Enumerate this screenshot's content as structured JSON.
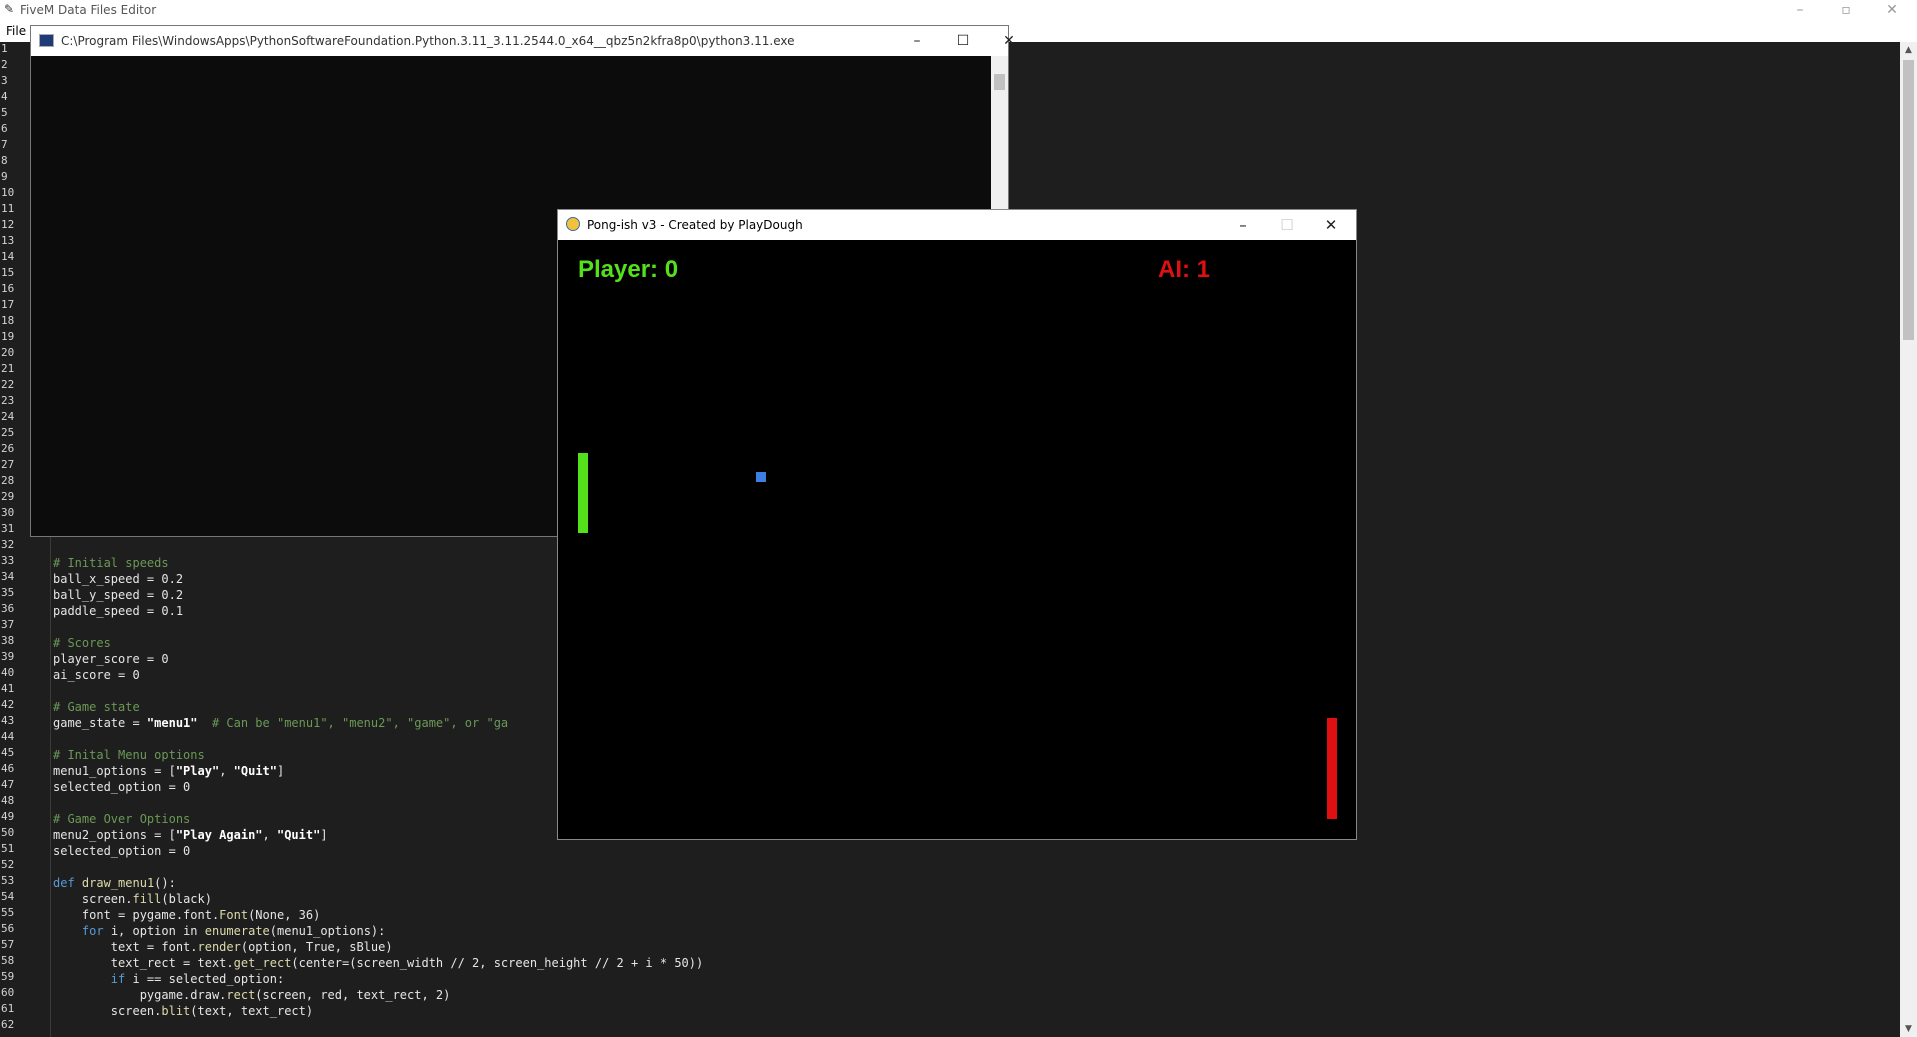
{
  "editor": {
    "title": "FiveM Data Files Editor",
    "menu_file": "File",
    "line_numbers": [
      "1",
      "2",
      "3",
      "4",
      "5",
      "6",
      "7",
      "8",
      "9",
      "10",
      "11",
      "12",
      "13",
      "14",
      "15",
      "16",
      "17",
      "18",
      "19",
      "20",
      "21",
      "22",
      "23",
      "24",
      "25",
      "26",
      "27",
      "28",
      "29",
      "30",
      "31",
      "32",
      "33",
      "34",
      "35",
      "36",
      "37",
      "38",
      "39",
      "40",
      "41",
      "42",
      "43",
      "44",
      "45",
      "46",
      "47",
      "48",
      "49",
      "50",
      "51",
      "52",
      "53",
      "54",
      "55",
      "56",
      "57",
      "58",
      "59",
      "60",
      "61",
      "62"
    ],
    "code": {
      "l33": "# Initial speeds",
      "l34": "ball_x_speed = 0.2",
      "l35": "ball_y_speed = 0.2",
      "l36": "paddle_speed = 0.1",
      "l38": "# Scores",
      "l39": "player_score = 0",
      "l40": "ai_score = 0",
      "l42": "# Game state",
      "l43_a": "game_state = ",
      "l43_b": "\"menu1\"",
      "l43_c": "  # Can be \"menu1\", \"menu2\", \"game\", or \"ga",
      "l45": "# Inital Menu options",
      "l46_a": "menu1_options = [",
      "l46_b": "\"Play\"",
      "l46_c": ", ",
      "l46_d": "\"Quit\"",
      "l46_e": "]",
      "l47": "selected_option = 0",
      "l49": "# Game Over Options",
      "l50_a": "menu2_options = [",
      "l50_b": "\"Play Again\"",
      "l50_c": ", ",
      "l50_d": "\"Quit\"",
      "l50_e": "]",
      "l51": "selected_option = 0",
      "l53_a": "def",
      "l53_b": "draw_menu1",
      "l53_c": "():",
      "l54_a": "    screen.",
      "l54_b": "fill",
      "l54_c": "(black)",
      "l55_a": "    font = pygame.font.",
      "l55_b": "Font",
      "l55_c": "(None, 36)",
      "l56_a": "    ",
      "l56_b": "for",
      "l56_c": " i, option in ",
      "l56_d": "enumerate",
      "l56_e": "(menu1_options):",
      "l57_a": "        text = font.",
      "l57_b": "render",
      "l57_c": "(option, True, sBlue)",
      "l58_a": "        text_rect = text.",
      "l58_b": "get_rect",
      "l58_c": "(center=(screen_width // 2, screen_height // 2 + i * 50))",
      "l59_a": "        ",
      "l59_b": "if",
      "l59_c": " i == selected_option:",
      "l60_a": "            pygame.draw.",
      "l60_b": "rect",
      "l60_c": "(screen, red, text_rect, 2)",
      "l61_a": "        screen.",
      "l61_b": "blit",
      "l61_c": "(text, text_rect)"
    }
  },
  "console": {
    "title": "C:\\Program Files\\WindowsApps\\PythonSoftwareFoundation.Python.3.11_3.11.2544.0_x64__qbz5n2kfra8p0\\python3.11.exe"
  },
  "pong": {
    "title": "Pong-ish v3 - Created by PlayDough",
    "player_score": "Player: 0",
    "ai_score": "AI: 1",
    "colors": {
      "player": "#55e01c",
      "ai": "#e01010",
      "ball": "#3c7fe0"
    }
  }
}
